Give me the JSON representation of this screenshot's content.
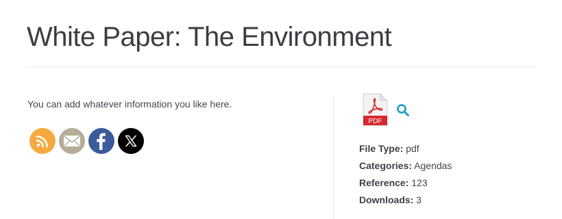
{
  "page": {
    "title": "White Paper: The Environment"
  },
  "intro": {
    "text": "You can add whatever information you like here."
  },
  "share": {
    "icons": [
      {
        "name": "rss-icon",
        "color": "#f5a93f"
      },
      {
        "name": "email-icon",
        "color": "#b6ad98"
      },
      {
        "name": "facebook-icon",
        "color": "#3c5b9b"
      },
      {
        "name": "x-icon",
        "color": "#000000"
      }
    ]
  },
  "file": {
    "icon": "pdf-file-icon",
    "icon_text": "PDF",
    "icon_accent": "#d7282f",
    "search_icon": "search-icon",
    "search_color": "#1f9bc7"
  },
  "meta": {
    "file_type_label": "File Type:",
    "file_type": "pdf",
    "categories_label": "Categories:",
    "categories": "Agendas",
    "reference_label": "Reference:",
    "reference": "123",
    "downloads_label": "Downloads:",
    "downloads": "3"
  }
}
